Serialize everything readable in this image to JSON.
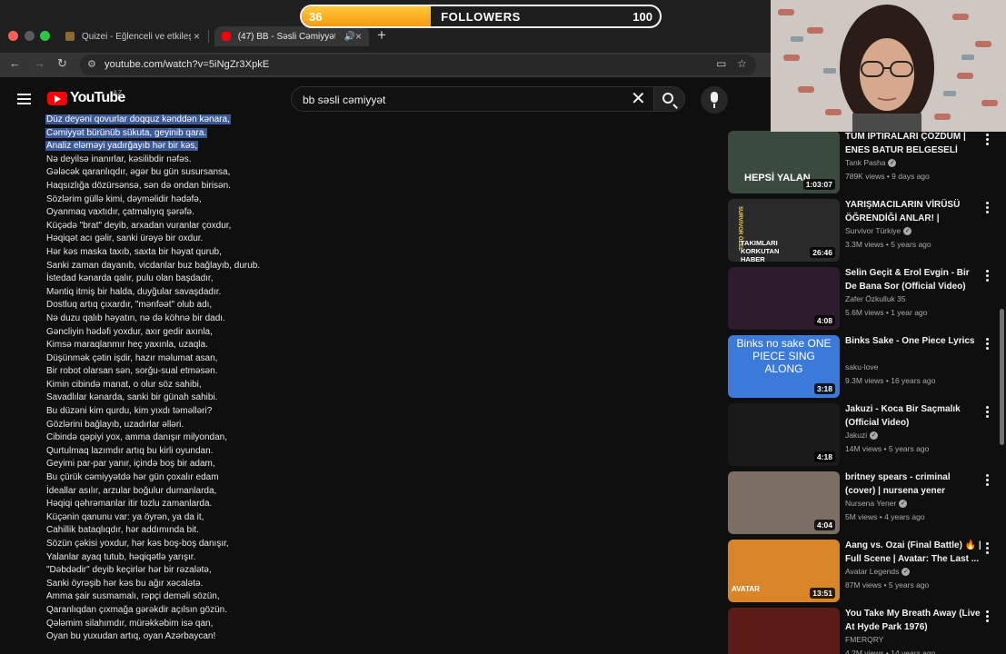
{
  "browser": {
    "tabs": [
      {
        "title": "Quizei - Eğlenceli ve etkileşim",
        "active": false
      },
      {
        "title": "(47) BB - Səsli Cəmiyyət",
        "active": true
      }
    ],
    "url": "youtube.com/watch?v=5iNgZr3XpkE"
  },
  "youtube": {
    "logo_text": "YouTube",
    "country": "AZ",
    "search_value": "bb səsli cəmiyyət"
  },
  "lyrics": {
    "lines": [
      "Düz deyəni qovurlar doqquz kənddən kənara,",
      "Cəmiyyət bürünüb sükuta, geyinib qara.",
      "Analiz eləməyi yadırğayıb hər bir kəs,",
      "Nə deyilsə inanırlar, kəsilibdir nəfəs.",
      "Gələcək qaranlıqdır, əgər bu gün susursansa,",
      "Haqsızlığa dözürsənsə, sən də ondan birisən.",
      "Sözlərim güllə kimi, dəyməlidir hədəfə,",
      "Oyanmaq vaxtıdır, çatmalıyıq şərəfə.",
      "Küçədə \"brat\" deyib, arxadan vuranlar çoxdur,",
      "Həqiqət acı gəlir, sanki ürəyə bir oxdur.",
      "Hər kəs maska taxıb, saxta bir həyat qurub,",
      "Sanki zaman dayanıb, vicdanlar buz bağlayıb, durub.",
      "İstedad kənarda qalır, pulu olan başdadır,",
      "Məntiq itmiş bir halda, duyğular savaşdadır.",
      "Dostluq artıq çıxardır, \"mənfəət\" olub adı,",
      "Nə duzu qalıb həyatın, nə də köhnə bir dadı.",
      "Gəncliyin hədəfi yoxdur, axır gedir axınla,",
      "Kimsə maraqlanmır heç yaxınla, uzaqla.",
      "Düşünmək çətin işdir, hazır məlumat asan,",
      "Bir robot olarsan sən, sorğu-sual etməsən.",
      "Kimin cibində manat, o olur söz sahibi,",
      "Savadlılar kənarda, sanki bir günah sahibi.",
      "Bu düzəni kim qurdu, kim yıxdı təməlləri?",
      "Gözlərini bağlayıb, uzadırlar əlləri.",
      "Cibində qəpiyi yox, amma danışır milyondan,",
      "Qurtulmaq lazımdır artıq bu kirli oyundan.",
      "Geyimi par-par yanır, içində boş bir adam,",
      "Bu çürük cəmiyyətdə hər gün çoxalır edam",
      "İdeallar asılır, arzular boğulur dumanlarda,",
      "Həqiqi qəhrəmanlar itir tozlu zamanlarda.",
      "Küçənin qanunu var: ya öyrən, ya da it,",
      "Cahillik bataqlıqdır, hər addımında bit.",
      "Sözün çəkisi yoxdur, hər kəs boş-boş danışır,",
      "Yalanlar ayaq tutub, həqiqətlə yarışır.",
      "\"Dəbdədir\" deyib keçirlər hər bir rəzalətə,",
      "Sanki öyrəşib hər kəs bu ağır xəcalətə.",
      "Amma şair susmamalı, rəpçi deməli sözün,",
      "Qaranlıqdan çıxmağa gərəkdir açılsın gözün.",
      "Qələmim silahımdır, mürəkkəbim isə qan,",
      "Oyan bu yuxudan artıq, oyan Azərbaycan!"
    ]
  },
  "recommendations": [
    {
      "title": "TÜM IPTIRALARI ÇÖZDÜM | ENES BATUR BELGESELİ",
      "channel": "Tank Pasha",
      "verified": true,
      "meta": "789K views • 9 days ago",
      "duration": "1:03:07",
      "thumb_text": "HEPSİ YALAN",
      "thumb_color": "#3b4a3e"
    },
    {
      "title": "YARIŞMACILARIN VİRÜSÜ ÖĞRENDİĞİ ANLAR! | SURVİV...",
      "channel": "Survivor Türkiye",
      "verified": true,
      "meta": "3.3M views • 5 years ago",
      "duration": "26:46",
      "thumb_text": "TAKIMLARI KORKUTAN HABER",
      "thumb_badge": "SURVIVOR ÖZEL",
      "thumb_color": "#2a2a2a"
    },
    {
      "title": "Selin Geçit & Erol Evgin - Bir De Bana Sor (Official Video)",
      "channel": "Zafer Özkulluk 35",
      "verified": false,
      "meta": "5.6M views • 1 year ago",
      "duration": "4:08",
      "thumb_color": "#2d1b2e"
    },
    {
      "title": "Binks Sake - One Piece Lyrics",
      "channel": "saku·love",
      "verified": false,
      "meta": "9.3M views • 16 years ago",
      "duration": "3:18",
      "thumb_text": "Binks no sake ONE PIECE SING ALONG",
      "thumb_color": "#3b7ad8"
    },
    {
      "title": "Jakuzi - Koca Bir Saçmalık (Official Video)",
      "channel": "Jakuzi",
      "verified": true,
      "meta": "14M views • 5 years ago",
      "duration": "4:18",
      "thumb_color": "#1a1a1a"
    },
    {
      "title": "britney spears - criminal (cover) | nursena yener",
      "channel": "Nursena Yener",
      "verified": true,
      "meta": "5M views • 4 years ago",
      "duration": "4:04",
      "thumb_color": "#7a6f62"
    },
    {
      "title": "Aang vs. Ozai (Final Battle) 🔥 | Full Scene | Avatar: The Last ...",
      "channel": "Avatar Legends",
      "verified": true,
      "meta": "87M views • 5 years ago",
      "duration": "13:51",
      "thumb_text": "AVATAR",
      "thumb_color": "#d9852a"
    },
    {
      "title": "You Take My Breath Away (Live At Hyde Park 1976)",
      "channel": "FMERQRY",
      "verified": false,
      "meta": "4.2M views • 14 years ago",
      "duration": "",
      "thumb_color": "#5a1c14"
    }
  ],
  "followers_overlay": {
    "current": 36,
    "goal": 100,
    "label": "FOLLOWERS",
    "progress_fraction": 0.36
  }
}
